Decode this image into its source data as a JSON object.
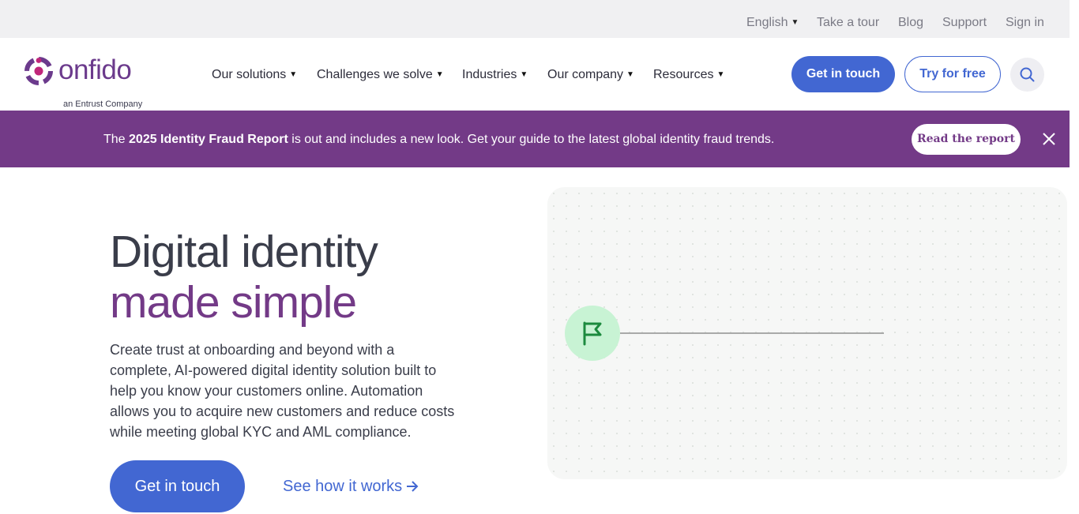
{
  "utility_bar": {
    "language": "English",
    "links": [
      "Take a tour",
      "Blog",
      "Support",
      "Sign in"
    ]
  },
  "logo": {
    "wordmark": "onfido",
    "tagline": "an Entrust Company"
  },
  "nav": {
    "menu": [
      "Our solutions",
      "Challenges we solve",
      "Industries",
      "Our company",
      "Resources"
    ],
    "get_in_touch": "Get in touch",
    "try_for_free": "Try for free"
  },
  "banner": {
    "prefix": "The ",
    "highlight": "2025 Identity Fraud Report",
    "suffix": " is out and includes a new look. Get your guide to the latest global identity fraud trends.",
    "button": "Read the report"
  },
  "hero": {
    "title_line1": "Digital identity",
    "title_line2": "made simple",
    "description": "Create trust at onboarding and beyond with a complete, AI-powered digital identity solution built to help you know your customers online.  Automation allows you to acquire new customers and reduce costs while meeting global KYC and AML compliance.",
    "cta": "Get in touch",
    "link": "See how it works"
  },
  "icons": {
    "dropdown": "chevron-down-icon",
    "search": "search-icon",
    "close": "close-icon",
    "arrow": "arrow-right-icon",
    "flag": "flag-icon"
  },
  "colors": {
    "brand_purple": "#733a87",
    "primary_blue": "#4267d2",
    "flag_green": "#1c8a3e",
    "flag_bg": "#c8f3d4"
  }
}
